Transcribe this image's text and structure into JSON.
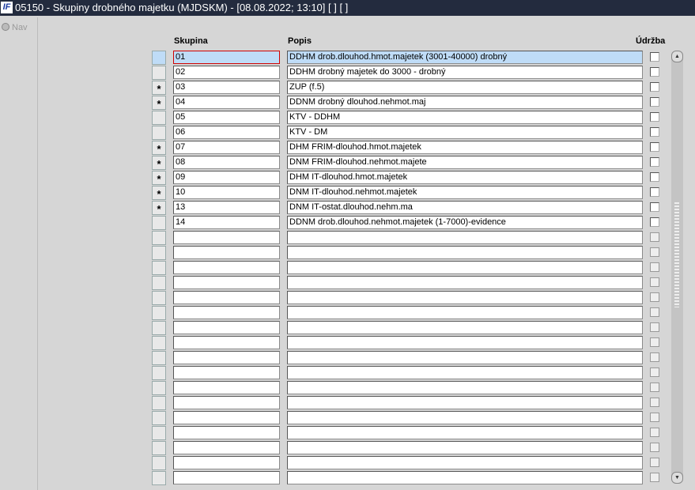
{
  "window": {
    "title": "05150 - Skupiny drobného majetku (MJDSKM) - [08.08.2022; 13:10]  [ ]  [ ]",
    "logo": "IF"
  },
  "nav": {
    "label": "Nav"
  },
  "headers": {
    "skupina": "Skupina",
    "popis": "Popis",
    "udrzba": "Údržba"
  },
  "rows": [
    {
      "mark": "",
      "skupina": "01",
      "popis": "DDHM drob.dlouhod.hmot.majetek (3001-40000) drobný"
    },
    {
      "mark": "",
      "skupina": "02",
      "popis": "DDHM drobný majetek do 3000 - drobný"
    },
    {
      "mark": "*",
      "skupina": "03",
      "popis": "ZUP  (f.5)"
    },
    {
      "mark": "*",
      "skupina": "04",
      "popis": "DDNM drobný dlouhod.nehmot.maj"
    },
    {
      "mark": "",
      "skupina": "05",
      "popis": "KTV - DDHM"
    },
    {
      "mark": "",
      "skupina": "06",
      "popis": "KTV - DM"
    },
    {
      "mark": "*",
      "skupina": "07",
      "popis": "DHM FRIM-dlouhod.hmot.majetek"
    },
    {
      "mark": "*",
      "skupina": "08",
      "popis": "DNM FRIM-dlouhod.nehmot.majete"
    },
    {
      "mark": "*",
      "skupina": "09",
      "popis": "DHM IT-dlouhod.hmot.majetek"
    },
    {
      "mark": "*",
      "skupina": "10",
      "popis": "DNM IT-dlouhod.nehmot.majetek"
    },
    {
      "mark": "*",
      "skupina": "13",
      "popis": "DNM IT-ostat.dlouhod.nehm.ma"
    },
    {
      "mark": "",
      "skupina": "14",
      "popis": "DDNM drob.dlouhod.nehmot.majetek (1-7000)-evidence"
    }
  ],
  "empty_rows": 17
}
